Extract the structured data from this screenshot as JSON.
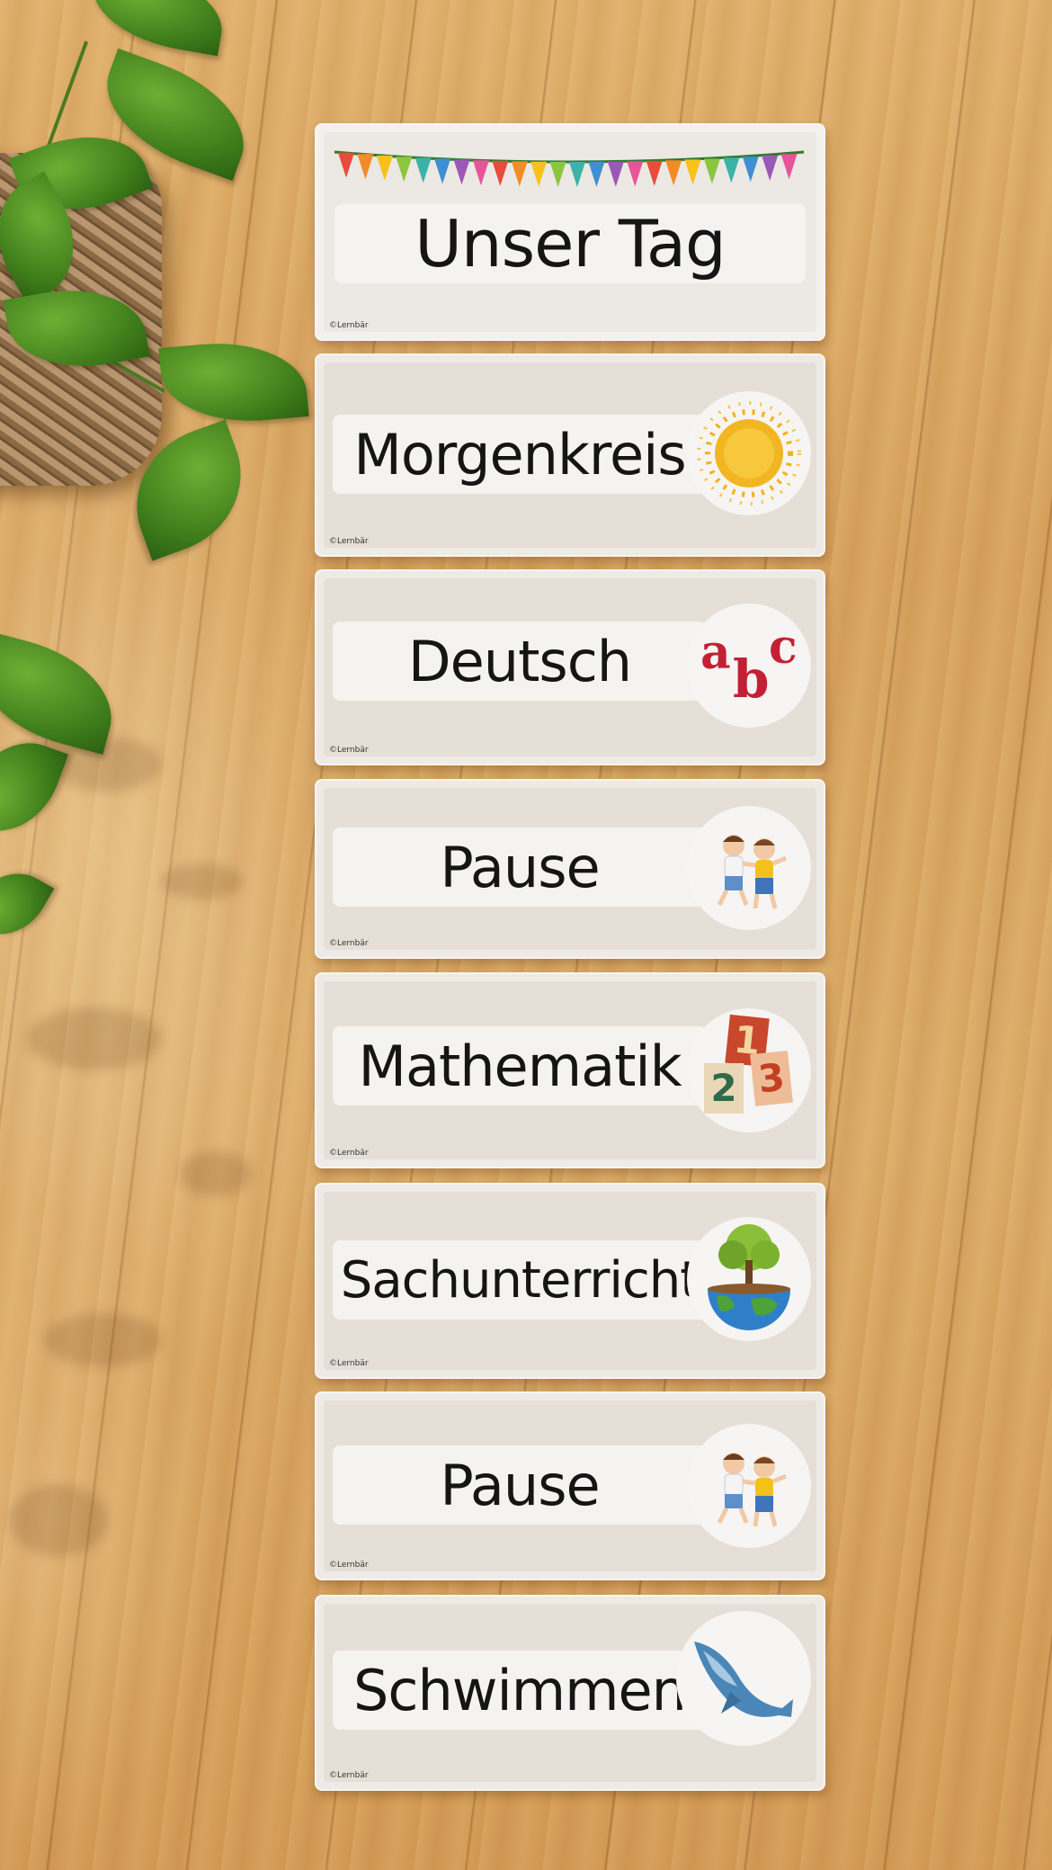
{
  "scene": {
    "subject": "classroom daily schedule cards on wooden floor",
    "colors": {
      "floor": "#d9a663",
      "card": "#eeebe6",
      "plant": "#4f8d24"
    }
  },
  "cards": [
    {
      "label": "Unser Tag",
      "icon": "bunting-icon",
      "copyright": "©Lernbär"
    },
    {
      "label": "Morgenkreis",
      "icon": "sun-icon",
      "copyright": "©Lernbär"
    },
    {
      "label": "Deutsch",
      "icon": "abc-letters-icon",
      "copyright": "©Lernbär"
    },
    {
      "label": "Pause",
      "icon": "children-playing-icon",
      "copyright": "©Lernbär"
    },
    {
      "label": "Mathematik",
      "icon": "number-blocks-icon",
      "copyright": "©Lernbär"
    },
    {
      "label": "Sachunterricht",
      "icon": "tree-globe-icon",
      "copyright": "©Lernbär"
    },
    {
      "label": "Pause",
      "icon": "children-playing-icon",
      "copyright": "©Lernbär"
    },
    {
      "label": "Schwimmen",
      "icon": "whale-icon",
      "copyright": "©Lernbär"
    }
  ],
  "icons": {
    "abc": {
      "a": "a",
      "b": "b",
      "c": "c"
    },
    "numbers": {
      "one": "1",
      "two": "2",
      "three": "3"
    }
  }
}
